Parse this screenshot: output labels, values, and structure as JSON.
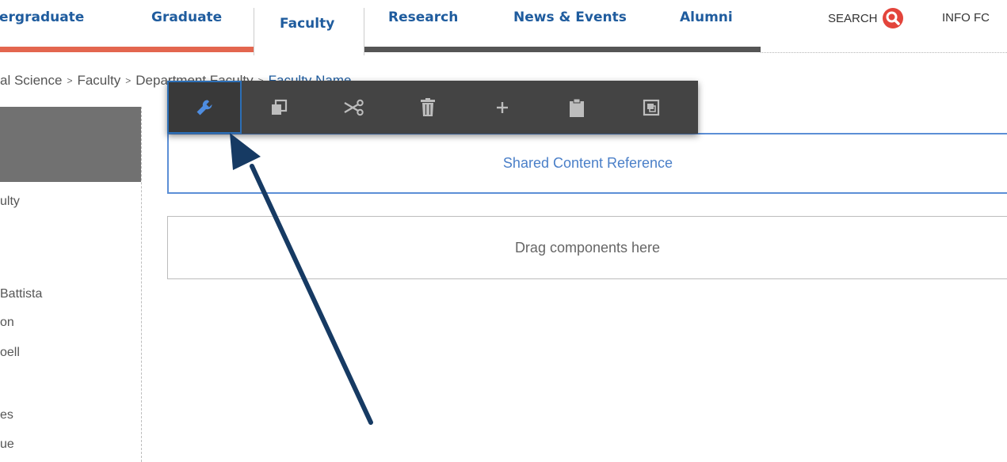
{
  "nav": {
    "tabs": [
      {
        "label": "ergraduate"
      },
      {
        "label": "Graduate"
      },
      {
        "label": "Faculty"
      },
      {
        "label": "Research"
      },
      {
        "label": "News & Events"
      },
      {
        "label": "Alumni"
      }
    ],
    "active_tab": "Faculty",
    "search_label": "SEARCH",
    "info_label": "INFO FC",
    "colors": {
      "tab_text": "#1f5c9e",
      "active_underline": "#e3664f",
      "search_icon": "#e3443b"
    }
  },
  "breadcrumb": {
    "items": [
      "al Science",
      "Faculty",
      "Department Faculty",
      "Faculty Name"
    ],
    "separator": ">"
  },
  "sidebar": {
    "items": [
      "ulty",
      "Battista",
      "on",
      "oell",
      "es",
      "ue"
    ]
  },
  "toolbar": {
    "tools": [
      {
        "name": "edit",
        "icon": "wrench-icon",
        "active": true
      },
      {
        "name": "copy",
        "icon": "copy-icon"
      },
      {
        "name": "cut",
        "icon": "scissors-icon"
      },
      {
        "name": "delete",
        "icon": "trash-icon"
      },
      {
        "name": "insert",
        "icon": "plus-icon"
      },
      {
        "name": "paste",
        "icon": "clipboard-icon"
      },
      {
        "name": "group",
        "icon": "group-icon"
      }
    ]
  },
  "content": {
    "shared_reference_label": "Shared Content Reference",
    "drop_zone_label": "Drag components here"
  },
  "annotation": {
    "arrow_color": "#163a63"
  }
}
